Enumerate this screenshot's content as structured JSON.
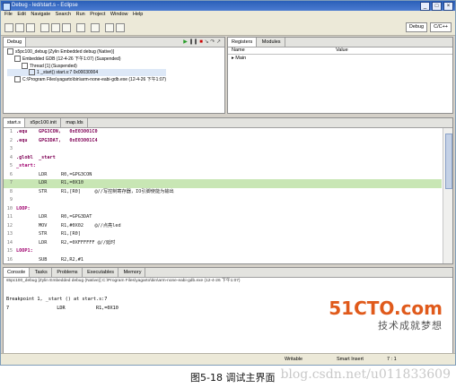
{
  "window": {
    "title": "Debug - led/start.s - Eclipse"
  },
  "menu": [
    "File",
    "Edit",
    "Navigate",
    "Search",
    "Run",
    "Project",
    "Window",
    "Help"
  ],
  "perspectives": {
    "debug": "Debug",
    "cpp": "C/C++"
  },
  "debug_view": {
    "tab": "Debug",
    "tree": [
      "s5pc100_debug [Zylin Embedded debug (Native)]",
      "Embedded GDB (12-4-26 下午1:07) (Suspended)",
      "Thread [1] (Suspended)",
      "1 _start() start.s:7 0x00030004",
      "C:\\Program Files\\yagarto\\bin\\arm-none-eabi-gdb.exe (12-4-26 下午1:07)"
    ]
  },
  "registers_view": {
    "tabs": [
      "Registers",
      "Modules"
    ],
    "columns": [
      "Name",
      "Value"
    ],
    "rows": [
      "Main"
    ]
  },
  "editor": {
    "tabs": [
      "start.s",
      "s5pc100.init",
      "map.lds"
    ],
    "lines": [
      {
        "num": "1",
        "text": ".equ    GPG3CON,   0xE03001C0"
      },
      {
        "num": "2",
        "text": ".equ    GPG3DAT,   0xE03001C4"
      },
      {
        "num": "3",
        "text": ""
      },
      {
        "num": "4",
        "text": ".globl  _start"
      },
      {
        "num": "5",
        "text": "_start:"
      },
      {
        "num": "6",
        "text": "        LDR     R0,=GPG3CON"
      },
      {
        "num": "7",
        "text": "        LDR     R1,=0X10"
      },
      {
        "num": "8",
        "text": "        STR     R1,[R0]     @//写控制寄存器，IO引脚使能为输出"
      },
      {
        "num": "9",
        "text": ""
      },
      {
        "num": "10",
        "text": "LOOP:"
      },
      {
        "num": "11",
        "text": "        LDR     R0,=GPG3DAT"
      },
      {
        "num": "12",
        "text": "        MOV     R1,#0X02    @//点亮led"
      },
      {
        "num": "13",
        "text": "        STR     R1,[R0]"
      },
      {
        "num": "14",
        "text": "        LDR     R2,=0XFFFFFF @//延时"
      },
      {
        "num": "15",
        "text": "LOOP1:"
      },
      {
        "num": "16",
        "text": "        SUB     R2,R2,#1"
      }
    ],
    "highlight_line": "7"
  },
  "console": {
    "tabs": [
      "Console",
      "Tasks",
      "Problems",
      "Executables",
      "Memory"
    ],
    "subtitle": "s5pc100_debug [Zylin Embedded debug (Native)] C:\\Program Files\\yagarto\\bin\\arm-none-eabi-gdb.exe (12-4-26 下午1:07)",
    "lines": [
      "Breakpoint 1, _start () at start.s:7",
      "7                 LDR           R1,=0X10"
    ]
  },
  "status": {
    "writable": "Writable",
    "insert": "Smart Insert",
    "position": "7 : 1"
  },
  "watermark": {
    "brand": "51CTO.com",
    "slogan": "技术成就梦想"
  },
  "caption": {
    "text": "图5-18   调试主界面",
    "url": "blog.csdn.net/u011833609"
  }
}
